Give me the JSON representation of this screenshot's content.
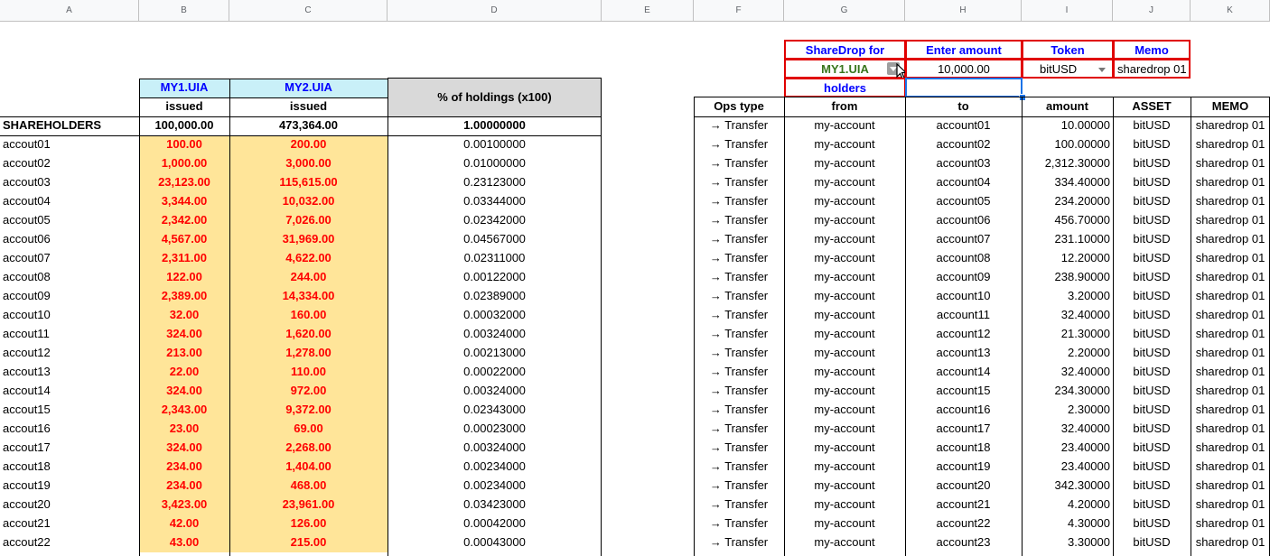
{
  "columns": [
    "A",
    "B",
    "C",
    "D",
    "E",
    "F",
    "G",
    "H",
    "I",
    "J",
    "K"
  ],
  "left": {
    "b_top": "MY1.UIA",
    "c_top": "MY2.UIA",
    "issued_b": "issued",
    "issued_c": "issued",
    "d_header": "% of holdings (x100)",
    "shareholders_label": "SHAREHOLDERS",
    "total_b": "100,000.00",
    "total_c": "473,364.00",
    "total_d": "1.00000000",
    "rows": [
      {
        "a": "accout01",
        "b": "100.00",
        "c": "200.00",
        "d": "0.00100000"
      },
      {
        "a": "accout02",
        "b": "1,000.00",
        "c": "3,000.00",
        "d": "0.01000000"
      },
      {
        "a": "accout03",
        "b": "23,123.00",
        "c": "115,615.00",
        "d": "0.23123000"
      },
      {
        "a": "accout04",
        "b": "3,344.00",
        "c": "10,032.00",
        "d": "0.03344000"
      },
      {
        "a": "accout05",
        "b": "2,342.00",
        "c": "7,026.00",
        "d": "0.02342000"
      },
      {
        "a": "accout06",
        "b": "4,567.00",
        "c": "31,969.00",
        "d": "0.04567000"
      },
      {
        "a": "accout07",
        "b": "2,311.00",
        "c": "4,622.00",
        "d": "0.02311000"
      },
      {
        "a": "accout08",
        "b": "122.00",
        "c": "244.00",
        "d": "0.00122000"
      },
      {
        "a": "accout09",
        "b": "2,389.00",
        "c": "14,334.00",
        "d": "0.02389000"
      },
      {
        "a": "accout10",
        "b": "32.00",
        "c": "160.00",
        "d": "0.00032000"
      },
      {
        "a": "accout11",
        "b": "324.00",
        "c": "1,620.00",
        "d": "0.00324000"
      },
      {
        "a": "accout12",
        "b": "213.00",
        "c": "1,278.00",
        "d": "0.00213000"
      },
      {
        "a": "accout13",
        "b": "22.00",
        "c": "110.00",
        "d": "0.00022000"
      },
      {
        "a": "accout14",
        "b": "324.00",
        "c": "972.00",
        "d": "0.00324000"
      },
      {
        "a": "accout15",
        "b": "2,343.00",
        "c": "9,372.00",
        "d": "0.02343000"
      },
      {
        "a": "accout16",
        "b": "23.00",
        "c": "69.00",
        "d": "0.00023000"
      },
      {
        "a": "accout17",
        "b": "324.00",
        "c": "2,268.00",
        "d": "0.00324000"
      },
      {
        "a": "accout18",
        "b": "234.00",
        "c": "1,404.00",
        "d": "0.00234000"
      },
      {
        "a": "accout19",
        "b": "234.00",
        "c": "468.00",
        "d": "0.00234000"
      },
      {
        "a": "accout20",
        "b": "3,423.00",
        "c": "23,961.00",
        "d": "0.03423000"
      },
      {
        "a": "accout21",
        "b": "42.00",
        "c": "126.00",
        "d": "0.00042000"
      },
      {
        "a": "accout22",
        "b": "43.00",
        "c": "215.00",
        "d": "0.00043000"
      }
    ]
  },
  "controls": {
    "sharedrop_for": "ShareDrop for",
    "enter_amount": "Enter amount",
    "token": "Token",
    "memo": "Memo",
    "asset_value": "MY1.UIA",
    "amount_value": "10,000.00",
    "token_value": "bitUSD",
    "memo_value": "sharedrop 01",
    "holders": "holders"
  },
  "ops": {
    "headers": [
      "Ops type",
      "from",
      "to",
      "amount",
      "ASSET",
      "MEMO"
    ],
    "rows": [
      {
        "type": "→ Transfer",
        "from": "my-account",
        "to": "account01",
        "amount": "10.00000",
        "asset": "bitUSD",
        "memo": "sharedrop 01"
      },
      {
        "type": "→ Transfer",
        "from": "my-account",
        "to": "account02",
        "amount": "100.00000",
        "asset": "bitUSD",
        "memo": "sharedrop 01"
      },
      {
        "type": "→ Transfer",
        "from": "my-account",
        "to": "account03",
        "amount": "2,312.30000",
        "asset": "bitUSD",
        "memo": "sharedrop 01"
      },
      {
        "type": "→ Transfer",
        "from": "my-account",
        "to": "account04",
        "amount": "334.40000",
        "asset": "bitUSD",
        "memo": "sharedrop 01"
      },
      {
        "type": "→ Transfer",
        "from": "my-account",
        "to": "account05",
        "amount": "234.20000",
        "asset": "bitUSD",
        "memo": "sharedrop 01"
      },
      {
        "type": "→ Transfer",
        "from": "my-account",
        "to": "account06",
        "amount": "456.70000",
        "asset": "bitUSD",
        "memo": "sharedrop 01"
      },
      {
        "type": "→ Transfer",
        "from": "my-account",
        "to": "account07",
        "amount": "231.10000",
        "asset": "bitUSD",
        "memo": "sharedrop 01"
      },
      {
        "type": "→ Transfer",
        "from": "my-account",
        "to": "account08",
        "amount": "12.20000",
        "asset": "bitUSD",
        "memo": "sharedrop 01"
      },
      {
        "type": "→ Transfer",
        "from": "my-account",
        "to": "account09",
        "amount": "238.90000",
        "asset": "bitUSD",
        "memo": "sharedrop 01"
      },
      {
        "type": "→ Transfer",
        "from": "my-account",
        "to": "account10",
        "amount": "3.20000",
        "asset": "bitUSD",
        "memo": "sharedrop 01"
      },
      {
        "type": "→ Transfer",
        "from": "my-account",
        "to": "account11",
        "amount": "32.40000",
        "asset": "bitUSD",
        "memo": "sharedrop 01"
      },
      {
        "type": "→ Transfer",
        "from": "my-account",
        "to": "account12",
        "amount": "21.30000",
        "asset": "bitUSD",
        "memo": "sharedrop 01"
      },
      {
        "type": "→ Transfer",
        "from": "my-account",
        "to": "account13",
        "amount": "2.20000",
        "asset": "bitUSD",
        "memo": "sharedrop 01"
      },
      {
        "type": "→ Transfer",
        "from": "my-account",
        "to": "account14",
        "amount": "32.40000",
        "asset": "bitUSD",
        "memo": "sharedrop 01"
      },
      {
        "type": "→ Transfer",
        "from": "my-account",
        "to": "account15",
        "amount": "234.30000",
        "asset": "bitUSD",
        "memo": "sharedrop 01"
      },
      {
        "type": "→ Transfer",
        "from": "my-account",
        "to": "account16",
        "amount": "2.30000",
        "asset": "bitUSD",
        "memo": "sharedrop 01"
      },
      {
        "type": "→ Transfer",
        "from": "my-account",
        "to": "account17",
        "amount": "32.40000",
        "asset": "bitUSD",
        "memo": "sharedrop 01"
      },
      {
        "type": "→ Transfer",
        "from": "my-account",
        "to": "account18",
        "amount": "23.40000",
        "asset": "bitUSD",
        "memo": "sharedrop 01"
      },
      {
        "type": "→ Transfer",
        "from": "my-account",
        "to": "account19",
        "amount": "23.40000",
        "asset": "bitUSD",
        "memo": "sharedrop 01"
      },
      {
        "type": "→ Transfer",
        "from": "my-account",
        "to": "account20",
        "amount": "342.30000",
        "asset": "bitUSD",
        "memo": "sharedrop 01"
      },
      {
        "type": "→ Transfer",
        "from": "my-account",
        "to": "account21",
        "amount": "4.20000",
        "asset": "bitUSD",
        "memo": "sharedrop 01"
      },
      {
        "type": "→ Transfer",
        "from": "my-account",
        "to": "account22",
        "amount": "4.30000",
        "asset": "bitUSD",
        "memo": "sharedrop 01"
      },
      {
        "type": "→ Transfer",
        "from": "my-account",
        "to": "account23",
        "amount": "3.30000",
        "asset": "bitUSD",
        "memo": "sharedrop 01"
      }
    ]
  },
  "colors": {
    "red": "#ff0000",
    "blue": "#0000ff",
    "green": "#38761d",
    "yellow_fill": "#ffe599",
    "light_blue_fill": "#c9f0f8",
    "grey_fill": "#d9d9d9",
    "selection": "#1a73e8"
  }
}
